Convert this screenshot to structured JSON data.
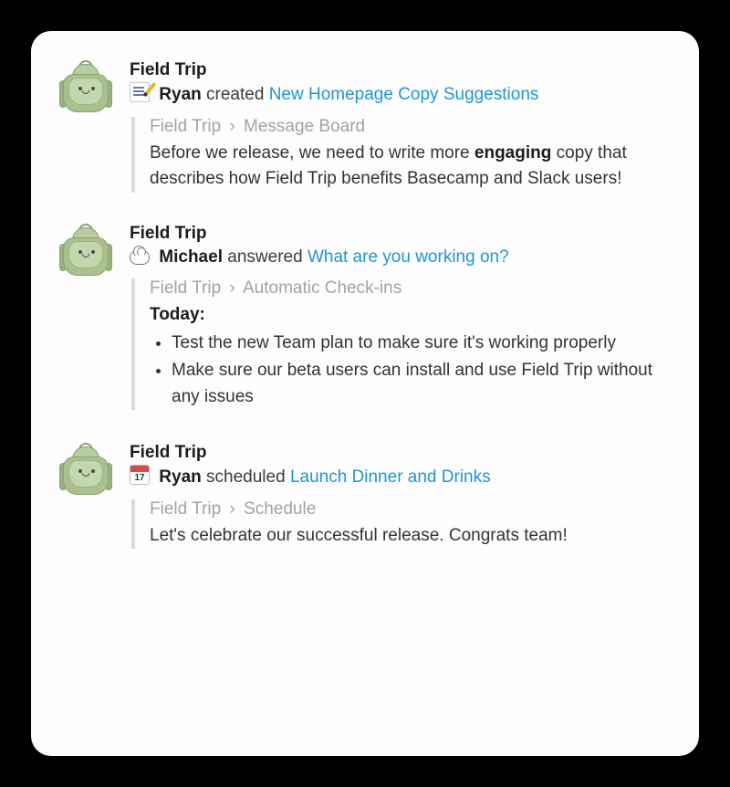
{
  "messages": [
    {
      "app": "Field Trip",
      "actor": "Ryan",
      "verb": "created",
      "link": "New Homepage Copy Suggestions",
      "breadcrumb_root": "Field Trip",
      "breadcrumb_leaf": "Message Board",
      "body_html": "Before we release, we need to write more <strong>engaging</strong> copy that describes how Field Trip benefits Basecamp and Slack users!"
    },
    {
      "app": "Field Trip",
      "actor": "Michael",
      "verb": "answered",
      "link": "What are you working on?",
      "breadcrumb_root": "Field Trip",
      "breadcrumb_leaf": "Automatic Check-ins",
      "body_html": "<strong>Today:</strong><ul><li>Test the new Team plan to make sure it's working properly</li><li>Make sure our beta users can install and use Field Trip without any issues</li></ul>"
    },
    {
      "app": "Field Trip",
      "actor": "Ryan",
      "verb": "scheduled",
      "link": "Launch Dinner and Drinks",
      "breadcrumb_root": "Field Trip",
      "breadcrumb_leaf": "Schedule",
      "body_html": "Let's celebrate our successful release. Congrats team!"
    }
  ],
  "sep": "›"
}
